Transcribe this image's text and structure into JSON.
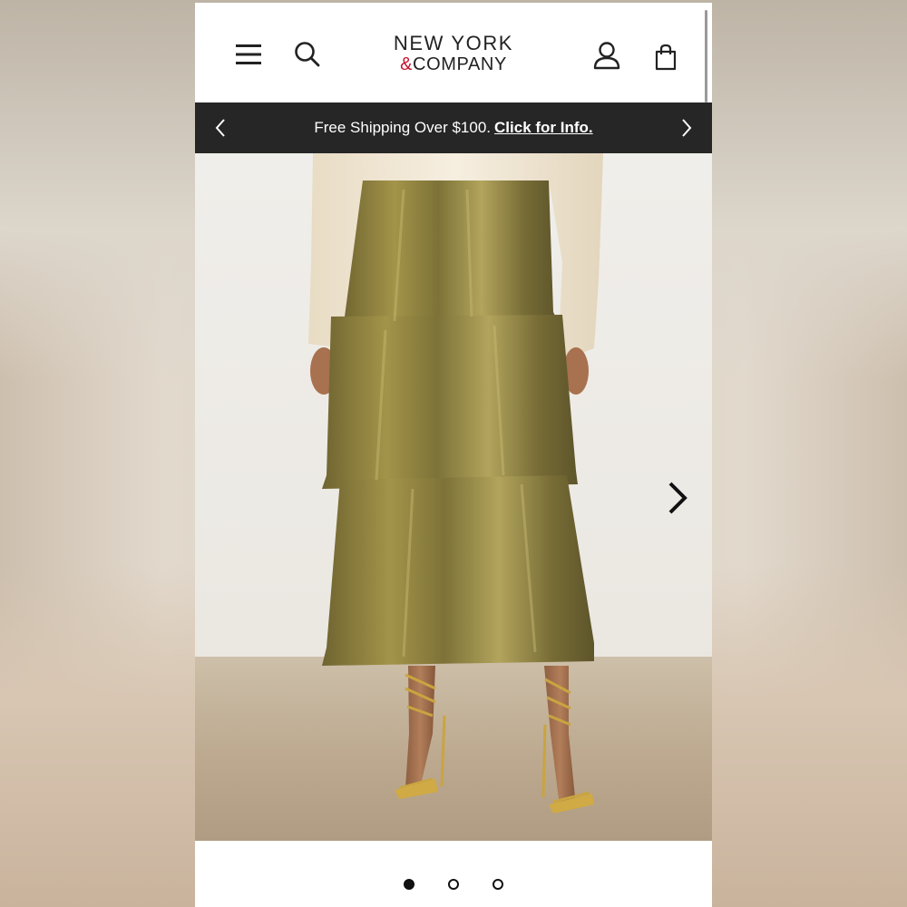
{
  "header": {
    "brand_line1": "NEW YORK",
    "brand_amp": "&",
    "brand_line2": "COMPANY",
    "icons": [
      "hamburger-menu-icon",
      "search-icon",
      "account-icon",
      "shopping-bag-icon"
    ]
  },
  "promo": {
    "text": "Free Shipping Over $100.",
    "link": "Click for Info."
  },
  "carousel": {
    "slide_count": 3,
    "active_index": 0,
    "image_description": "Model wearing cream sweater and gold metallic tiered midi skirt with strappy gold heels"
  },
  "colors": {
    "brand_amp": "#c8102e",
    "promo_bg": "#262626",
    "skirt_gold": "#8a7d3e"
  }
}
